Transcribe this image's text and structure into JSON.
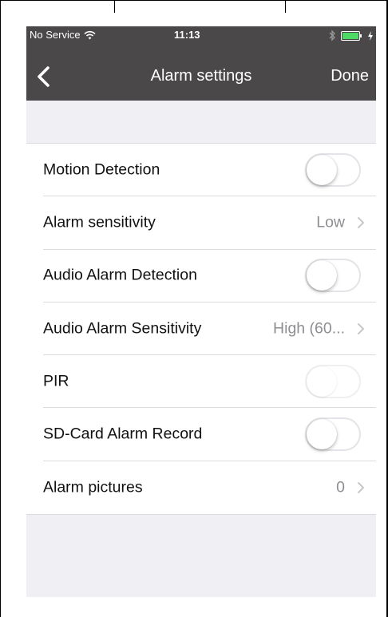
{
  "status_bar": {
    "carrier": "No Service",
    "time": "11:13"
  },
  "nav": {
    "title": "Alarm settings",
    "done_label": "Done"
  },
  "settings": {
    "motion_detection": {
      "label": "Motion Detection",
      "enabled": false
    },
    "alarm_sensitivity": {
      "label": "Alarm sensitivity",
      "value": "Low"
    },
    "audio_alarm_detection": {
      "label": "Audio Alarm Detection",
      "enabled": false
    },
    "audio_alarm_sensitivity": {
      "label": "Audio Alarm Sensitivity",
      "value": "High (60..."
    },
    "pir": {
      "label": "PIR",
      "enabled": false,
      "disabled": true
    },
    "sd_card_alarm_record": {
      "label": "SD-Card Alarm Record",
      "enabled": false
    },
    "alarm_pictures": {
      "label": "Alarm pictures",
      "value": "0"
    }
  },
  "colors": {
    "nav_bar": "#4a4848",
    "background": "#efeff4",
    "secondary_text": "#8e8e93",
    "battery": "#4cd964"
  },
  "icons": [
    "wifi-icon",
    "bluetooth-icon",
    "battery-icon",
    "charging-icon",
    "back-chevron-icon",
    "chevron-right-icon"
  ]
}
